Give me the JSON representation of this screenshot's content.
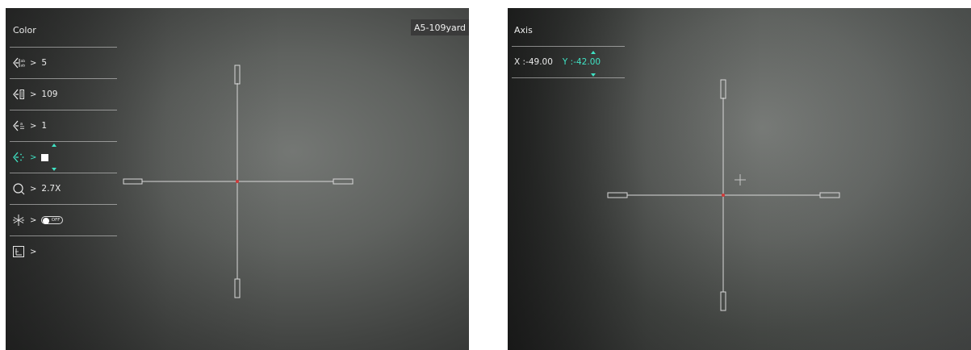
{
  "left_screen": {
    "menu_title": "Color",
    "items": [
      {
        "icon": "reticle-pattern-icon",
        "value": "5"
      },
      {
        "icon": "reticle-distance-icon",
        "value": "109"
      },
      {
        "icon": "reticle-group-icon",
        "value": "1"
      },
      {
        "icon": "reticle-color-icon",
        "value": "white-swatch"
      },
      {
        "icon": "zoom-icon",
        "value": "2.7X"
      },
      {
        "icon": "freeze-icon",
        "value": "OFF"
      },
      {
        "icon": "axis-icon",
        "value": ""
      }
    ],
    "chevron": ">",
    "badge": "A5-109yard"
  },
  "right_screen": {
    "menu_title": "Axis",
    "x_readout": "X :-49.00",
    "y_readout": "Y :-42.00"
  },
  "colors": {
    "accent": "#3fe3c4",
    "reticle_line": "#d8d8d8",
    "reticle_center": "#d23a3a",
    "badge_bg": "#3a3a3a"
  }
}
